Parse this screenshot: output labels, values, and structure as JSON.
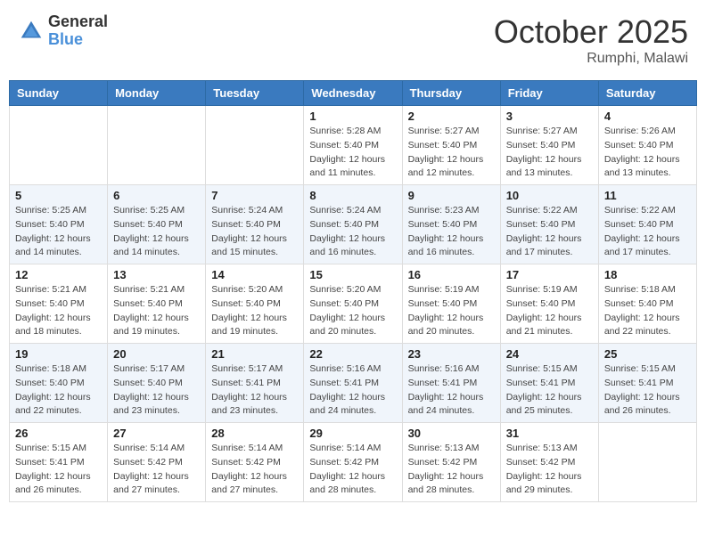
{
  "header": {
    "logo_general": "General",
    "logo_blue": "Blue",
    "month": "October 2025",
    "location": "Rumphi, Malawi"
  },
  "calendar": {
    "days_of_week": [
      "Sunday",
      "Monday",
      "Tuesday",
      "Wednesday",
      "Thursday",
      "Friday",
      "Saturday"
    ],
    "weeks": [
      [
        {
          "day": "",
          "info": ""
        },
        {
          "day": "",
          "info": ""
        },
        {
          "day": "",
          "info": ""
        },
        {
          "day": "1",
          "info": "Sunrise: 5:28 AM\nSunset: 5:40 PM\nDaylight: 12 hours\nand 11 minutes."
        },
        {
          "day": "2",
          "info": "Sunrise: 5:27 AM\nSunset: 5:40 PM\nDaylight: 12 hours\nand 12 minutes."
        },
        {
          "day": "3",
          "info": "Sunrise: 5:27 AM\nSunset: 5:40 PM\nDaylight: 12 hours\nand 13 minutes."
        },
        {
          "day": "4",
          "info": "Sunrise: 5:26 AM\nSunset: 5:40 PM\nDaylight: 12 hours\nand 13 minutes."
        }
      ],
      [
        {
          "day": "5",
          "info": "Sunrise: 5:25 AM\nSunset: 5:40 PM\nDaylight: 12 hours\nand 14 minutes."
        },
        {
          "day": "6",
          "info": "Sunrise: 5:25 AM\nSunset: 5:40 PM\nDaylight: 12 hours\nand 14 minutes."
        },
        {
          "day": "7",
          "info": "Sunrise: 5:24 AM\nSunset: 5:40 PM\nDaylight: 12 hours\nand 15 minutes."
        },
        {
          "day": "8",
          "info": "Sunrise: 5:24 AM\nSunset: 5:40 PM\nDaylight: 12 hours\nand 16 minutes."
        },
        {
          "day": "9",
          "info": "Sunrise: 5:23 AM\nSunset: 5:40 PM\nDaylight: 12 hours\nand 16 minutes."
        },
        {
          "day": "10",
          "info": "Sunrise: 5:22 AM\nSunset: 5:40 PM\nDaylight: 12 hours\nand 17 minutes."
        },
        {
          "day": "11",
          "info": "Sunrise: 5:22 AM\nSunset: 5:40 PM\nDaylight: 12 hours\nand 17 minutes."
        }
      ],
      [
        {
          "day": "12",
          "info": "Sunrise: 5:21 AM\nSunset: 5:40 PM\nDaylight: 12 hours\nand 18 minutes."
        },
        {
          "day": "13",
          "info": "Sunrise: 5:21 AM\nSunset: 5:40 PM\nDaylight: 12 hours\nand 19 minutes."
        },
        {
          "day": "14",
          "info": "Sunrise: 5:20 AM\nSunset: 5:40 PM\nDaylight: 12 hours\nand 19 minutes."
        },
        {
          "day": "15",
          "info": "Sunrise: 5:20 AM\nSunset: 5:40 PM\nDaylight: 12 hours\nand 20 minutes."
        },
        {
          "day": "16",
          "info": "Sunrise: 5:19 AM\nSunset: 5:40 PM\nDaylight: 12 hours\nand 20 minutes."
        },
        {
          "day": "17",
          "info": "Sunrise: 5:19 AM\nSunset: 5:40 PM\nDaylight: 12 hours\nand 21 minutes."
        },
        {
          "day": "18",
          "info": "Sunrise: 5:18 AM\nSunset: 5:40 PM\nDaylight: 12 hours\nand 22 minutes."
        }
      ],
      [
        {
          "day": "19",
          "info": "Sunrise: 5:18 AM\nSunset: 5:40 PM\nDaylight: 12 hours\nand 22 minutes."
        },
        {
          "day": "20",
          "info": "Sunrise: 5:17 AM\nSunset: 5:40 PM\nDaylight: 12 hours\nand 23 minutes."
        },
        {
          "day": "21",
          "info": "Sunrise: 5:17 AM\nSunset: 5:41 PM\nDaylight: 12 hours\nand 23 minutes."
        },
        {
          "day": "22",
          "info": "Sunrise: 5:16 AM\nSunset: 5:41 PM\nDaylight: 12 hours\nand 24 minutes."
        },
        {
          "day": "23",
          "info": "Sunrise: 5:16 AM\nSunset: 5:41 PM\nDaylight: 12 hours\nand 24 minutes."
        },
        {
          "day": "24",
          "info": "Sunrise: 5:15 AM\nSunset: 5:41 PM\nDaylight: 12 hours\nand 25 minutes."
        },
        {
          "day": "25",
          "info": "Sunrise: 5:15 AM\nSunset: 5:41 PM\nDaylight: 12 hours\nand 26 minutes."
        }
      ],
      [
        {
          "day": "26",
          "info": "Sunrise: 5:15 AM\nSunset: 5:41 PM\nDaylight: 12 hours\nand 26 minutes."
        },
        {
          "day": "27",
          "info": "Sunrise: 5:14 AM\nSunset: 5:42 PM\nDaylight: 12 hours\nand 27 minutes."
        },
        {
          "day": "28",
          "info": "Sunrise: 5:14 AM\nSunset: 5:42 PM\nDaylight: 12 hours\nand 27 minutes."
        },
        {
          "day": "29",
          "info": "Sunrise: 5:14 AM\nSunset: 5:42 PM\nDaylight: 12 hours\nand 28 minutes."
        },
        {
          "day": "30",
          "info": "Sunrise: 5:13 AM\nSunset: 5:42 PM\nDaylight: 12 hours\nand 28 minutes."
        },
        {
          "day": "31",
          "info": "Sunrise: 5:13 AM\nSunset: 5:42 PM\nDaylight: 12 hours\nand 29 minutes."
        },
        {
          "day": "",
          "info": ""
        }
      ]
    ]
  }
}
